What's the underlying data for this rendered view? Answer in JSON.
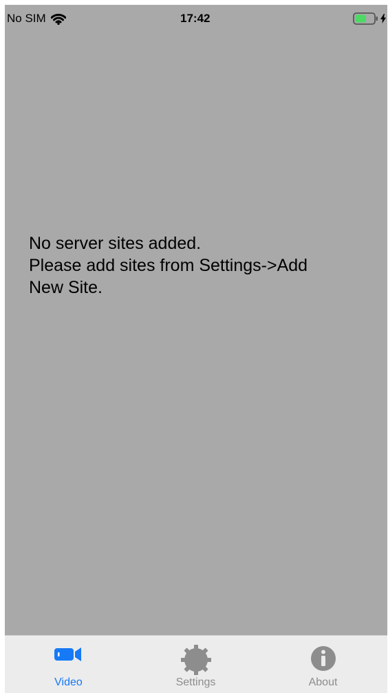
{
  "status_bar": {
    "carrier": "No SIM",
    "time": "17:42",
    "wifi_icon": "wifi-icon",
    "battery_icon": "battery-charging-icon",
    "battery_level": 0.62,
    "battery_color": "#4cd964"
  },
  "main": {
    "message_lines": [
      "No server sites added.",
      "Please add sites from Settings->Add",
      "New Site."
    ]
  },
  "tab_bar": {
    "items": [
      {
        "label": "Video",
        "icon": "video-camera-icon",
        "active": true,
        "color": "#1679f6"
      },
      {
        "label": "Settings",
        "icon": "gear-icon",
        "active": false,
        "color": "#8d8d8d"
      },
      {
        "label": "About",
        "icon": "info-icon",
        "active": false,
        "color": "#8d8d8d"
      }
    ]
  },
  "theme": {
    "background": "#a9a9a9",
    "tabbar_background": "#ececec",
    "accent": "#1679f6"
  }
}
